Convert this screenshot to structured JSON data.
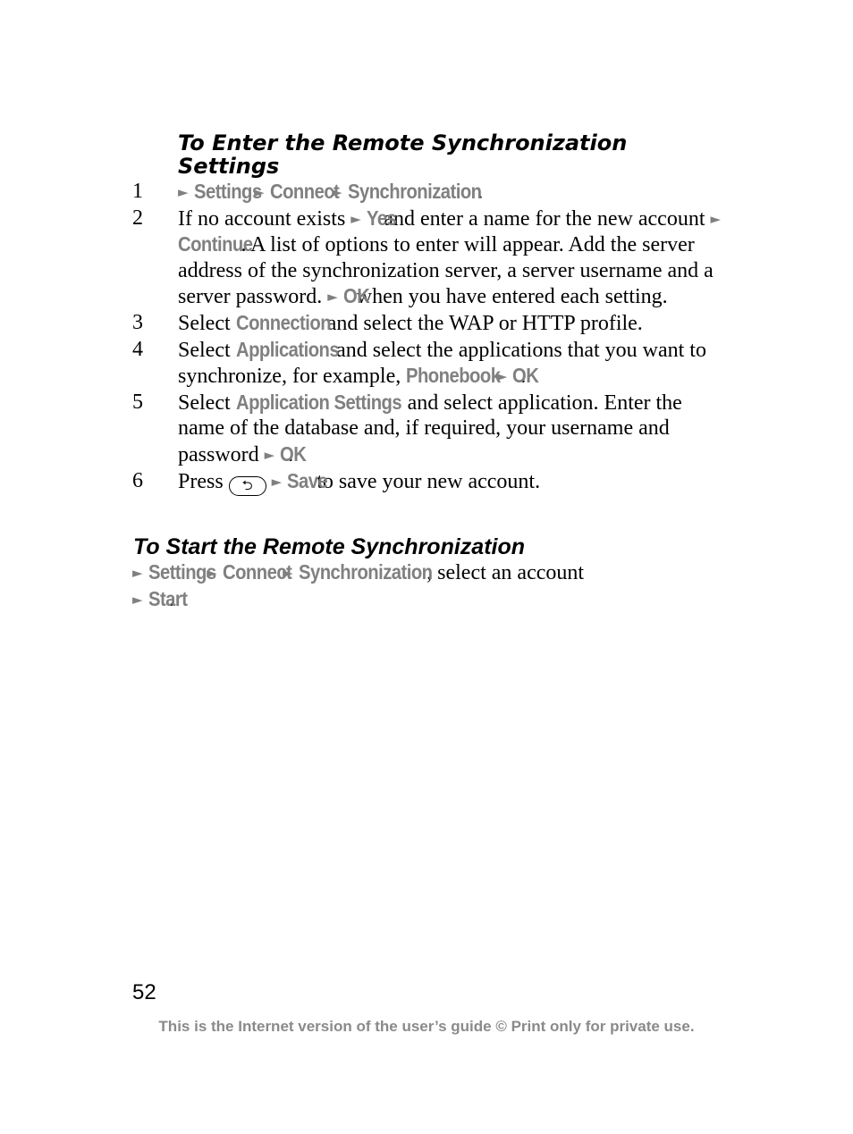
{
  "section1": {
    "title": "To Enter the Remote Synchronization Settings",
    "steps": [
      {
        "num": "1",
        "menu": [
          "Settings",
          "Connect",
          "Synchronization"
        ],
        "end": "."
      },
      {
        "num": "2",
        "t1": "If no account exists",
        "ui1": "Yes",
        "t2": "and enter a name for the new account",
        "ui2": "Continue",
        "t3": ". A list of options to enter will appear. Add the server address of the synchronization server, a server username and a server password.",
        "ui3": "OK",
        "t4": "when you have entered each setting."
      },
      {
        "num": "3",
        "t1": "Select",
        "ui1": "Connection",
        "t2": "and select the WAP or HTTP profile."
      },
      {
        "num": "4",
        "t1": "Select",
        "ui1": "Applications",
        "t2": "and select the applications that you want to synchronize, for example,",
        "ui2": "Phonebook",
        "ui3": "OK",
        "t3": "."
      },
      {
        "num": "5",
        "t1": "Select",
        "ui1": "Application Settings",
        "t2": "and select application. Enter the name of the database and, if required, your username and password",
        "ui2": "OK",
        "t3": "."
      },
      {
        "num": "6",
        "t1": "Press",
        "key_icon": "back-key",
        "ui1": "Save",
        "t2": "to save your new account."
      }
    ]
  },
  "section2": {
    "title": "To Start the Remote Synchronization",
    "menu": [
      "Settings",
      "Connect",
      "Synchronization"
    ],
    "t1": ", select an account",
    "ui_last": "Start",
    "end": "."
  },
  "page_number": "52",
  "footer": "This is the Internet version of the user’s guide © Print only for private use.",
  "arrow_glyph": "►",
  "colors": {
    "ui_text": "#808080",
    "footer_text": "#8a8a8a"
  }
}
